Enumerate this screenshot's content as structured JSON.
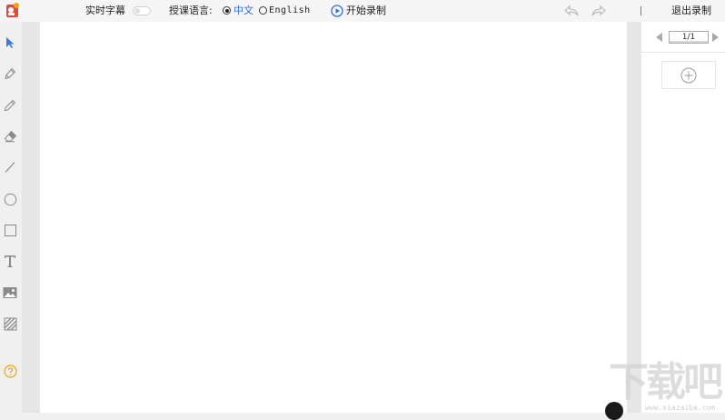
{
  "topbar": {
    "subtitle_label": "实时字幕",
    "language_label": "授课语言:",
    "lang_options": [
      "中文",
      "English"
    ],
    "record_label": "开始录制",
    "exit_label": "退出录制"
  },
  "pager": {
    "page_indicator": "1/1"
  },
  "watermark": {
    "text": "下载吧",
    "url": "www.xiazaiba.com"
  },
  "colors": {
    "accent": "#2f6fd6",
    "help": "#f0a500",
    "icon_gray": "#8a8a8a"
  },
  "icons": {
    "logo": "app-logo-icon",
    "tools": [
      "select-pointer-icon",
      "pen-icon",
      "pencil-icon",
      "eraser-icon",
      "line-icon",
      "circle-icon",
      "rectangle-icon",
      "text-icon",
      "image-icon",
      "hatch-fill-icon",
      "help-icon"
    ]
  }
}
